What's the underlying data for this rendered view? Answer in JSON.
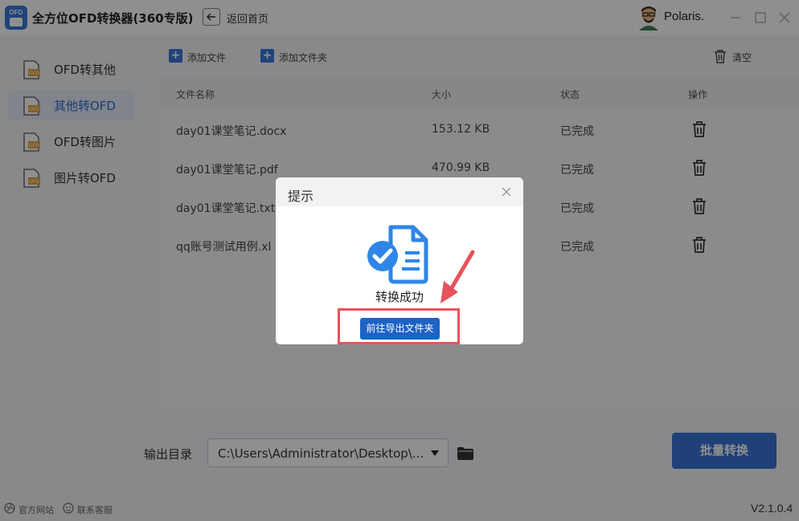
{
  "window": {
    "logo_text": "OFD",
    "title": "全方位OFD转换器(360专版)",
    "back_label": "返回首页",
    "username": "Polaris."
  },
  "sidebar": {
    "items": [
      {
        "label": "OFD转其他",
        "active": false
      },
      {
        "label": "其他转OFD",
        "active": true
      },
      {
        "label": "OFD转图片",
        "active": false
      },
      {
        "label": "图片转OFD",
        "active": false
      }
    ]
  },
  "toolbar": {
    "add_file": "添加文件",
    "add_folder": "添加文件夹",
    "clear": "清空"
  },
  "table": {
    "headers": [
      "文件名称",
      "大小",
      "状态",
      "操作"
    ],
    "rows": [
      {
        "name": "day01课堂笔记.docx",
        "size": "153.12 KB",
        "status": "已完成"
      },
      {
        "name": "day01课堂笔记.pdf",
        "size": "470.99 KB",
        "status": "已完成"
      },
      {
        "name": "day01课堂笔记.txt",
        "size": "",
        "status": "已完成"
      },
      {
        "name": "qq账号测试用例.xl",
        "size": "",
        "status": "已完成"
      }
    ]
  },
  "bottom": {
    "output_label": "输出目录",
    "output_path": "C:\\Users\\Administrator\\Desktop\\...",
    "batch_button": "批量转换"
  },
  "footer": {
    "site_link": "官方网站",
    "service_link": "联系客服",
    "version": "V2.1.0.4"
  },
  "dialog": {
    "title": "提示",
    "message": "转换成功",
    "button": "前往导出文件夹"
  },
  "colors": {
    "accent": "#3a74d6",
    "dialog_button": "#1d62c6",
    "highlight": "#e8525a",
    "sidebar_active_bg": "#e4ebf8"
  },
  "icons": {
    "back": "arrow-left-icon",
    "trash": "trash-icon",
    "folder": "folder-icon",
    "success": "document-check-icon",
    "close": "close-icon"
  }
}
